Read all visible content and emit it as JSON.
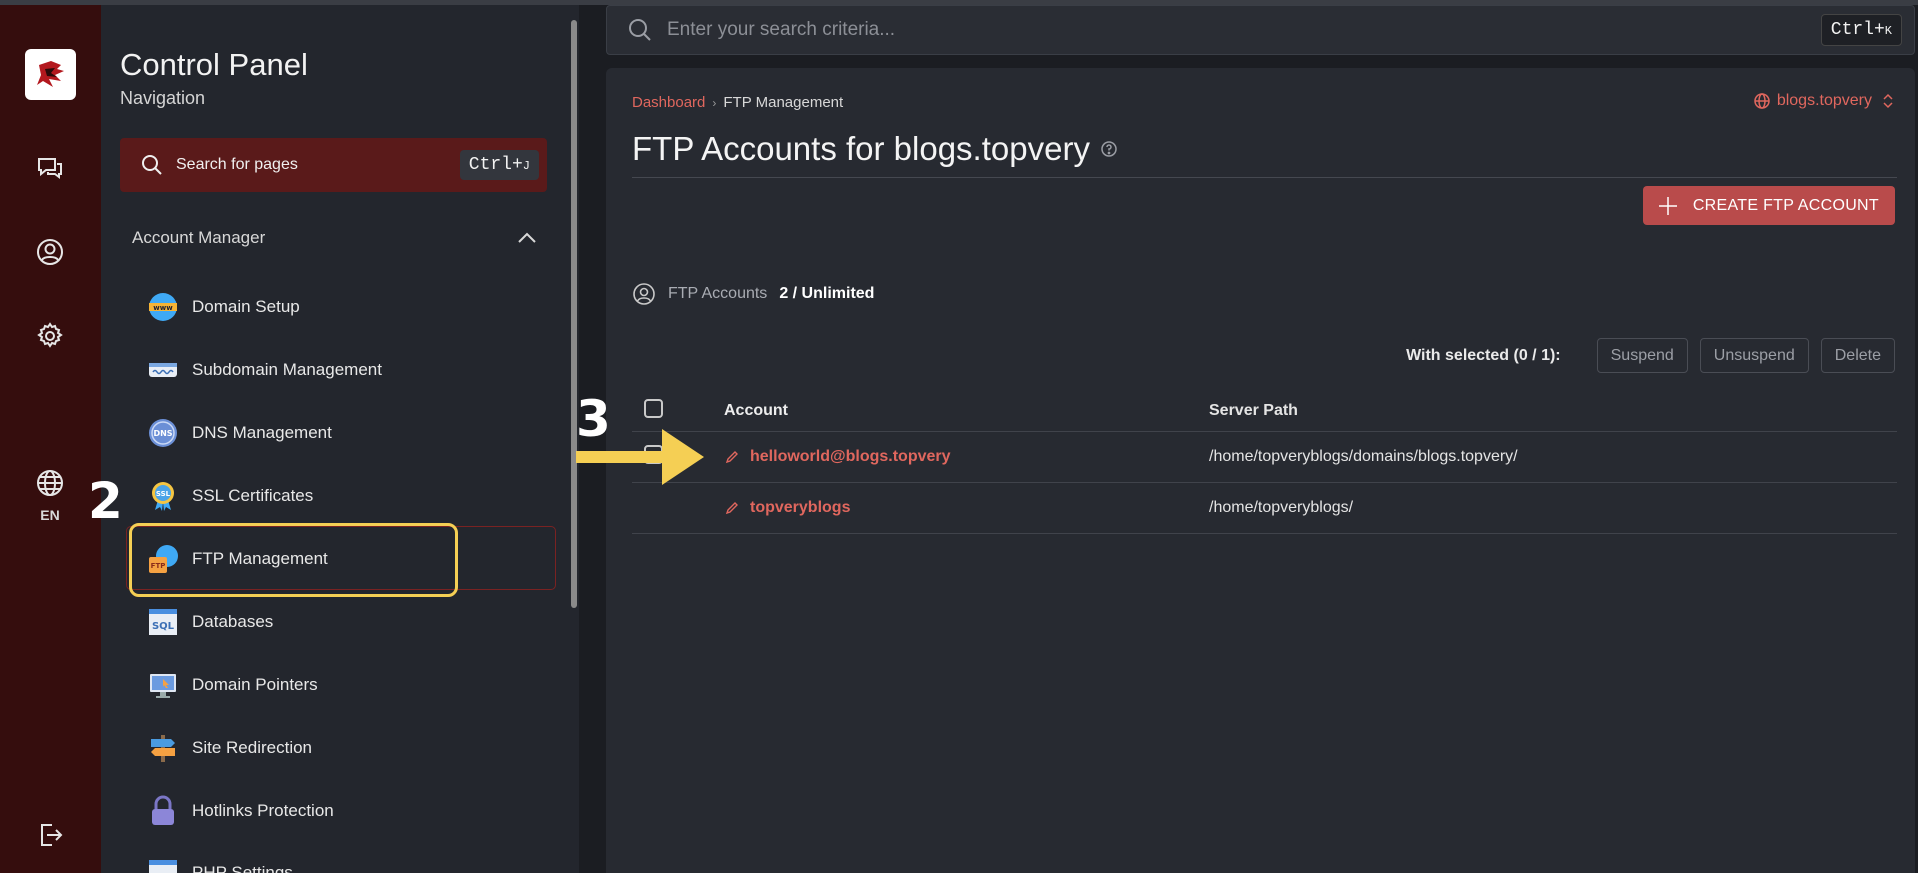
{
  "rail": {
    "items": [
      "chat-icon",
      "user-icon",
      "gear-icon",
      "globe-icon",
      "logout-icon"
    ],
    "language": "EN"
  },
  "nav": {
    "title": "Control Panel",
    "subtitle": "Navigation",
    "search": {
      "label": "Search for pages",
      "shortcut_key": "Ctrl+",
      "shortcut_letter": "J"
    },
    "section": "Account Manager",
    "items": [
      {
        "label": "Domain Setup",
        "icon": "www-globe-icon"
      },
      {
        "label": "Subdomain Management",
        "icon": "subdomain-icon"
      },
      {
        "label": "DNS Management",
        "icon": "dns-icon"
      },
      {
        "label": "SSL Certificates",
        "icon": "ssl-badge-icon"
      },
      {
        "label": "FTP Management",
        "icon": "ftp-icon",
        "active": true
      },
      {
        "label": "Databases",
        "icon": "sql-database-icon"
      },
      {
        "label": "Domain Pointers",
        "icon": "monitor-pointer-icon"
      },
      {
        "label": "Site Redirection",
        "icon": "signpost-icon"
      },
      {
        "label": "Hotlinks Protection",
        "icon": "lock-icon"
      },
      {
        "label": "PHP Settings",
        "icon": "php-icon"
      }
    ]
  },
  "annotations": {
    "step2": "2",
    "step3": "3"
  },
  "topbar": {
    "search_placeholder": "Enter your search criteria...",
    "shortcut_key": "Ctrl+",
    "shortcut_letter": "K"
  },
  "main": {
    "breadcrumb": [
      "Dashboard",
      "FTP Management"
    ],
    "domain": "blogs.topvery",
    "title": "FTP Accounts for blogs.topvery",
    "create_button": "CREATE FTP ACCOUNT",
    "quota_label": "FTP Accounts",
    "quota_value": "2 / Unlimited",
    "bulk": {
      "label": "With selected (0 / 1):",
      "actions": [
        "Suspend",
        "Unsuspend",
        "Delete"
      ]
    },
    "columns": [
      "Account",
      "Server Path"
    ],
    "rows": [
      {
        "account": "helloworld@blogs.topvery",
        "path": "/home/topveryblogs/domains/blogs.topvery/"
      },
      {
        "account": "topveryblogs",
        "path": "/home/topveryblogs/"
      }
    ]
  },
  "colors": {
    "rail_bg": "#350d0d",
    "accent": "#e0675e",
    "button": "#b94b4b",
    "highlight": "#f5cf54"
  }
}
